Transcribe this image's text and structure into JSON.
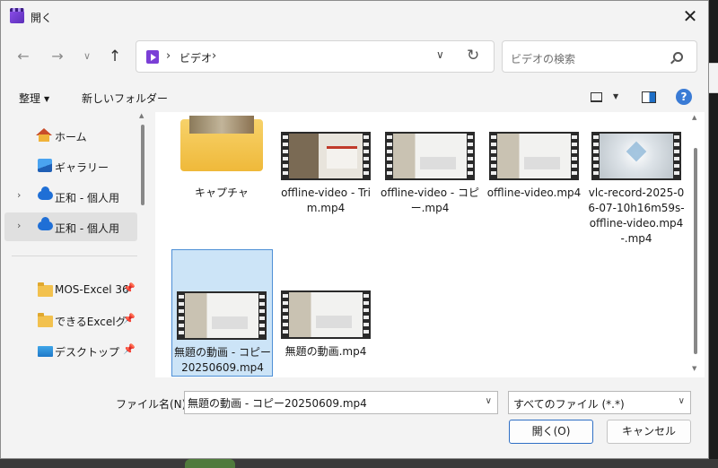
{
  "window": {
    "title": "開く"
  },
  "nav": {
    "back_glyph": "←",
    "forward_glyph": "→",
    "recent_glyph": "∨",
    "up_glyph": "↑"
  },
  "address": {
    "location": "ビデオ",
    "sep": "›",
    "dropdown_glyph": "∨",
    "refresh_glyph": "↻"
  },
  "search": {
    "placeholder": "ビデオの検索"
  },
  "commandbar": {
    "organize": "整理",
    "new_folder": "新しいフォルダー",
    "help": "?"
  },
  "sidebar": {
    "items": [
      {
        "label": "ホーム",
        "icon": "home-icon"
      },
      {
        "label": "ギャラリー",
        "icon": "gallery-icon"
      },
      {
        "label": "正和 - 個人用",
        "icon": "cloud-icon",
        "chevron": "›"
      },
      {
        "label": "正和 - 個人用",
        "icon": "cloud-icon",
        "chevron": "›",
        "selected": true
      },
      {
        "label": "MOS-Excel 36",
        "icon": "folder-icon",
        "pinned": true
      },
      {
        "label": "できるExcelグラフ",
        "icon": "folder-icon",
        "pinned": true
      },
      {
        "label": "デスクトップ",
        "icon": "desktop-icon",
        "pinned": true
      }
    ]
  },
  "files": [
    {
      "name": "キャプチャ",
      "type": "folder"
    },
    {
      "name": "offline-video - Trim.mp4",
      "type": "video"
    },
    {
      "name": "offline-video - コピー.mp4",
      "type": "video"
    },
    {
      "name": "offline-video.mp4",
      "type": "video"
    },
    {
      "name": "vlc-record-2025-06-07-10h16m59s-offline-video.mp4-.mp4",
      "type": "video"
    },
    {
      "name": "無題の動画 - コピー20250609.mp4",
      "type": "video",
      "selected": true
    },
    {
      "name": "無題の動画.mp4",
      "type": "video"
    }
  ],
  "footer": {
    "filename_label": "ファイル名(N):",
    "filename_value": "無題の動画 - コピー20250609.mp4",
    "filetype_value": "すべてのファイル (*.*)",
    "dropdown_glyph": "∨",
    "open_button": "開く(O)",
    "cancel_button": "キャンセル"
  },
  "colors": {
    "accent": "#2f6fc5",
    "selection": "#cce4f7",
    "folder": "#f2c14e"
  }
}
